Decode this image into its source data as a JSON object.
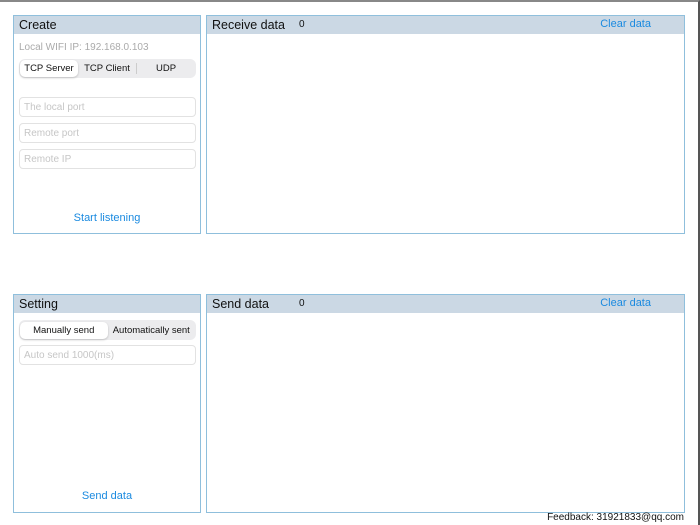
{
  "create": {
    "title": "Create",
    "local_ip": "Local WIFI IP: 192.168.0.103",
    "modes": [
      "TCP Server",
      "TCP Client",
      "UDP"
    ],
    "local_port_placeholder": "The local port",
    "remote_port_placeholder": "Remote port",
    "remote_ip_placeholder": "Remote IP",
    "start_label": "Start listening"
  },
  "receive": {
    "title": "Receive data",
    "count": "0",
    "clear_label": "Clear data"
  },
  "setting": {
    "title": "Setting",
    "modes": [
      "Manually send",
      "Automatically sent"
    ],
    "auto_send_placeholder": "Auto send 1000(ms)",
    "send_label": "Send data"
  },
  "send": {
    "title": "Send data",
    "count": "0",
    "clear_label": "Clear data"
  },
  "feedback": "Feedback: 31921833@qq.com"
}
